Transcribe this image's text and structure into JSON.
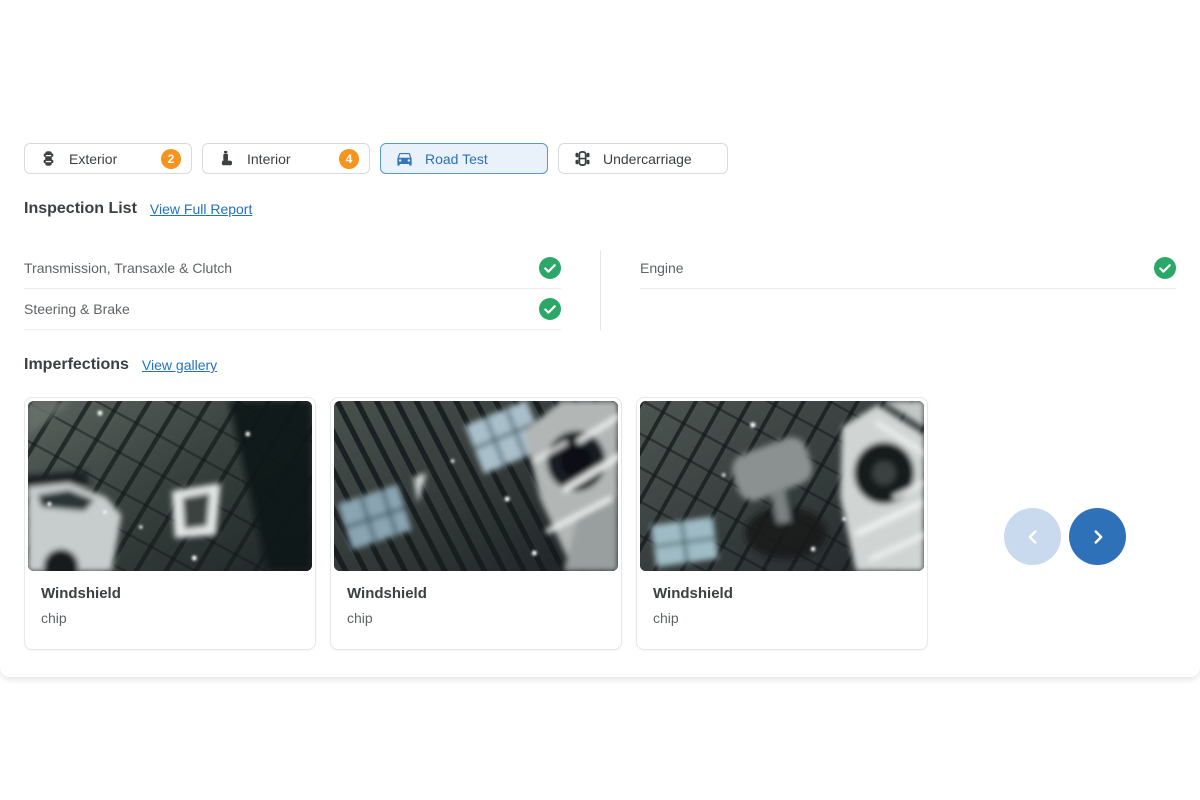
{
  "tabs": [
    {
      "label": "Exterior",
      "badge": "2",
      "icon": "car-exterior-icon",
      "selected": false
    },
    {
      "label": "Interior",
      "badge": "4",
      "icon": "car-seat-icon",
      "selected": false
    },
    {
      "label": "Road Test",
      "icon": "car-front-icon",
      "selected": true
    },
    {
      "label": "Undercarriage",
      "icon": "undercarriage-icon",
      "selected": false
    }
  ],
  "inspection_list": {
    "title": "Inspection List",
    "link_label": "View Full Report",
    "left_column": [
      {
        "label": "Transmission, Transaxle & Clutch",
        "status": "pass",
        "status_icon": "pass-check-icon"
      },
      {
        "label": "Steering & Brake",
        "status": "pass",
        "status_icon": "pass-check-icon"
      }
    ],
    "right_column": [
      {
        "label": "Engine",
        "status": "pass",
        "status_icon": "pass-check-icon"
      }
    ]
  },
  "imperfections": {
    "title": "Imperfections",
    "link_label": "View gallery",
    "cards": [
      {
        "title": "Windshield",
        "subtitle": "chip",
        "photo": "windshield-chip-photo"
      },
      {
        "title": "Windshield",
        "subtitle": "chip",
        "photo": "windshield-chip-photo"
      },
      {
        "title": "Windshield",
        "subtitle": "chip",
        "photo": "windshield-chip-photo"
      }
    ]
  },
  "carousel": {
    "prev_icon": "chevron-left-icon",
    "next_icon": "chevron-right-icon"
  },
  "colors": {
    "accent_blue": "#2e71b8",
    "prev_disabled_blue": "#c9daef",
    "selected_tab_bg": "#e9f1fa",
    "selected_tab_border": "#5b97d3",
    "selected_tab_text": "#2f6fb5",
    "badge_orange": "#f6941d",
    "pass_green": "#2ba768",
    "link_blue": "#2273c2"
  }
}
